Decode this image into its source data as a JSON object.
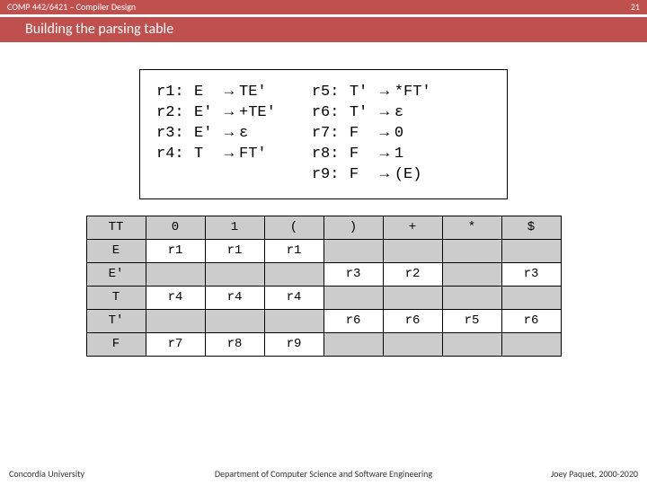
{
  "header": {
    "course": "COMP 442/6421 – Compiler Design",
    "page_no": "21"
  },
  "title": "Building the parsing table",
  "rules": {
    "left": [
      {
        "id": "r1:",
        "lhs": "E",
        "rhs": "TE'"
      },
      {
        "id": "r2:",
        "lhs": "E'",
        "rhs": "+TE'"
      },
      {
        "id": "r3:",
        "lhs": "E'",
        "rhs": "ε"
      },
      {
        "id": "r4:",
        "lhs": "T",
        "rhs": "FT'"
      }
    ],
    "right": [
      {
        "id": "r5:",
        "lhs": "T'",
        "rhs": "*FT'"
      },
      {
        "id": "r6:",
        "lhs": "T'",
        "rhs": "ε"
      },
      {
        "id": "r7:",
        "lhs": "F",
        "rhs": "0"
      },
      {
        "id": "r8:",
        "lhs": "F",
        "rhs": "1"
      },
      {
        "id": "r9:",
        "lhs": "F",
        "rhs": "(E)"
      }
    ]
  },
  "table": {
    "cols": [
      "TT",
      "0",
      "1",
      "(",
      ")",
      "+",
      "*",
      "$"
    ],
    "rows": [
      {
        "nt": "E",
        "cells": [
          "r1",
          "r1",
          "r1",
          "",
          "",
          "",
          ""
        ]
      },
      {
        "nt": "E'",
        "cells": [
          "",
          "",
          "",
          "r3",
          "r2",
          "",
          "r3"
        ]
      },
      {
        "nt": "T",
        "cells": [
          "r4",
          "r4",
          "r4",
          "",
          "",
          "",
          ""
        ]
      },
      {
        "nt": "T'",
        "cells": [
          "",
          "",
          "",
          "r6",
          "r6",
          "r5",
          "r6"
        ]
      },
      {
        "nt": "F",
        "cells": [
          "r7",
          "r8",
          "r9",
          "",
          "",
          "",
          ""
        ]
      }
    ]
  },
  "footer": {
    "left": "Concordia University",
    "center": "Department of Computer Science and Software Engineering",
    "right": "Joey Paquet, 2000-2020"
  },
  "arrow": "→"
}
